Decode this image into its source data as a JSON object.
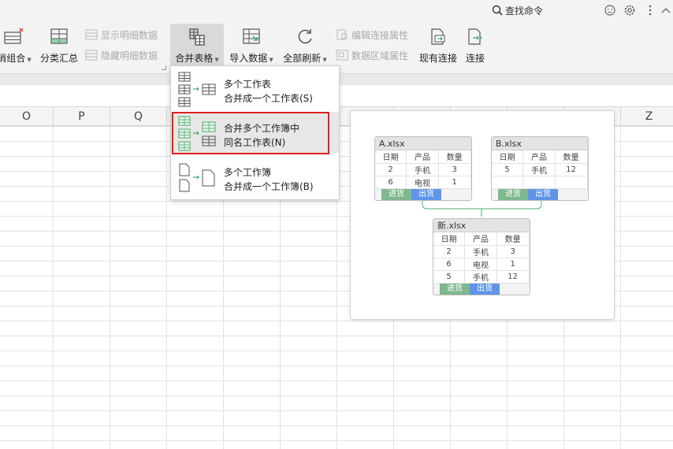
{
  "topbar": {
    "search_label": "查找命令"
  },
  "ribbon": {
    "ungroup_label": "消组合",
    "subtotal_label": "分类汇总",
    "show_detail_label": "显示明细数据",
    "hide_detail_label": "隐藏明细数据",
    "merge_table_label": "合并表格",
    "import_data_label": "导入数据",
    "refresh_all_label": "全部刷新",
    "edit_conn_label": "编辑连接属性",
    "data_range_label": "数据区域属性",
    "existing_conn_label": "现有连接",
    "connect_label": "连接"
  },
  "columns": [
    "O",
    "P",
    "Q",
    "Z"
  ],
  "menu": {
    "items": [
      {
        "line1": "多个工作表",
        "line2": "合并成一个工作表(S)"
      },
      {
        "line1": "合并多个工作簿中",
        "line2": "同名工作表(N)"
      },
      {
        "line1": "多个工作簿",
        "line2": "合并成一个工作簿(B)"
      }
    ]
  },
  "preview": {
    "headers": [
      "日期",
      "产品",
      "数量"
    ],
    "sheet_in": "进货",
    "sheet_out": "出货",
    "book_a": {
      "name": "A.xlsx",
      "rows": [
        [
          "2",
          "手机",
          "3"
        ],
        [
          "6",
          "电视",
          "1"
        ]
      ]
    },
    "book_b": {
      "name": "B.xlsx",
      "rows": [
        [
          "5",
          "手机",
          "12"
        ]
      ]
    },
    "book_new": {
      "name": "新.xlsx",
      "rows": [
        [
          "2",
          "手机",
          "3"
        ],
        [
          "6",
          "电视",
          "1"
        ],
        [
          "5",
          "手机",
          "12"
        ]
      ]
    }
  },
  "colors": {
    "accent_green": "#4caf6d",
    "sheet_in": "#7fb88e",
    "sheet_out": "#5f94e8",
    "highlight_border": "#e02020"
  }
}
